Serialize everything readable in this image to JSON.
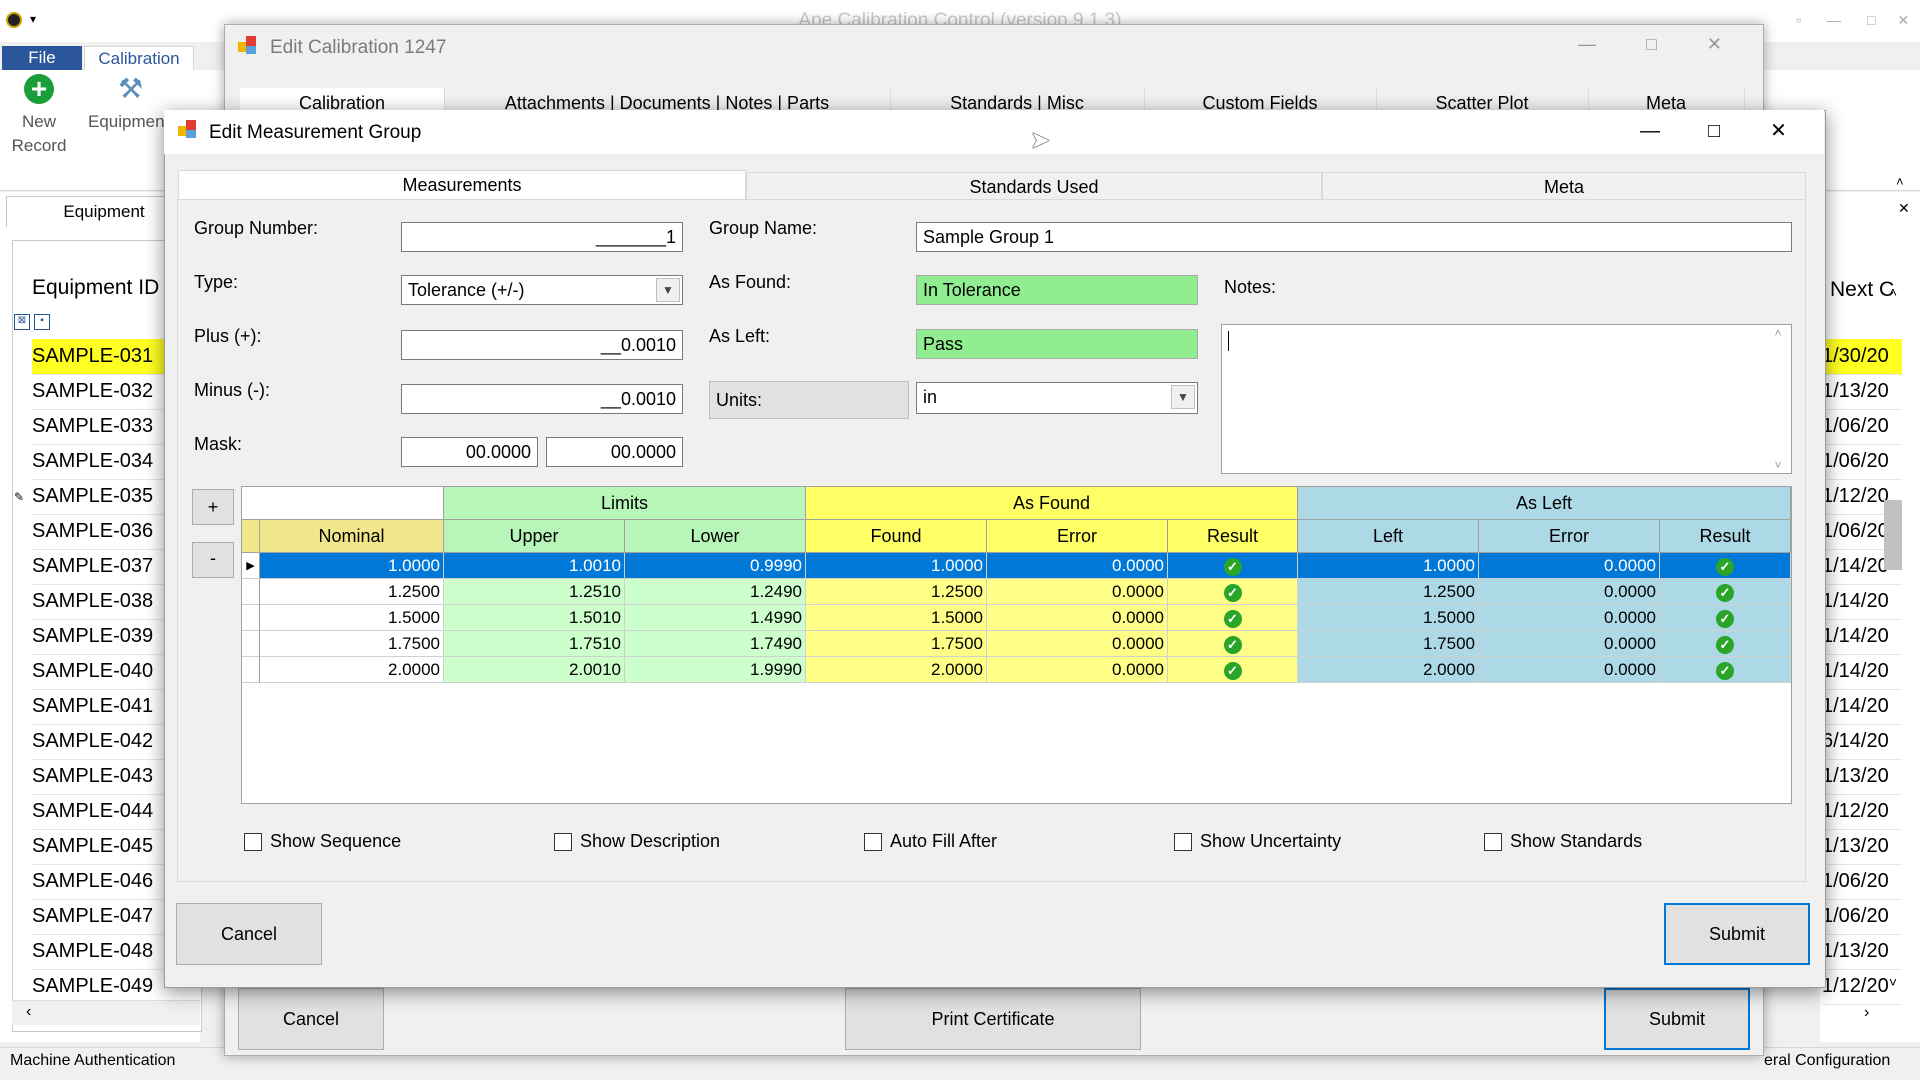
{
  "app": {
    "title": "Ape Calibration Control (version 9.1.3)",
    "ribbon_tabs": [
      "File",
      "Calibration"
    ],
    "new_record": "New Record",
    "equipment_btn": "Equipment",
    "equipment_tab": "Equipment",
    "equipment_id_header": "Equipment ID",
    "next_header": "Next C",
    "equipment_rows": [
      "SAMPLE-031",
      "SAMPLE-032",
      "SAMPLE-033",
      "SAMPLE-034",
      "SAMPLE-035",
      "SAMPLE-036",
      "SAMPLE-037",
      "SAMPLE-038",
      "SAMPLE-039",
      "SAMPLE-040",
      "SAMPLE-041",
      "SAMPLE-042",
      "SAMPLE-043",
      "SAMPLE-044",
      "SAMPLE-045",
      "SAMPLE-046",
      "SAMPLE-047",
      "SAMPLE-048",
      "SAMPLE-049"
    ],
    "next_rows": [
      "1/30/20",
      "1/13/20",
      "1/06/20",
      "1/06/20",
      "1/12/20",
      "1/06/20",
      "1/14/20",
      "1/14/20",
      "1/14/20",
      "1/14/20",
      "1/14/20",
      "6/14/20",
      "1/13/20",
      "1/12/20",
      "1/13/20",
      "1/06/20",
      "1/06/20",
      "1/13/20",
      "1/12/20"
    ],
    "status_left": "Machine Authentication",
    "status_right": "eral Configuration"
  },
  "calibration_window": {
    "title": "Edit Calibration 1247",
    "tabs": [
      "Calibration",
      "Attachments | Documents | Notes | Parts",
      "Standards | Misc",
      "Custom Fields",
      "Scatter Plot",
      "Meta"
    ],
    "cancel": "Cancel",
    "print_certificate": "Print Certificate",
    "submit": "Submit"
  },
  "measurement_group": {
    "title": "Edit Measurement Group",
    "tabs": [
      "Measurements",
      "Standards Used",
      "Meta"
    ],
    "group_number_label": "Group Number:",
    "group_number_value": "_______1",
    "group_name_label": "Group Name:",
    "group_name_value": "Sample Group 1",
    "type_label": "Type:",
    "type_value": "Tolerance (+/-)",
    "as_found_label": "As Found:",
    "as_found_value": "In Tolerance",
    "notes_label": "Notes:",
    "plus_label": "Plus (+):",
    "plus_value": "__0.0010",
    "as_left_label": "As Left:",
    "as_left_value": "Pass",
    "minus_label": "Minus (-):",
    "minus_value": "__0.0010",
    "units_label": "Units:",
    "units_value": "in",
    "mask_label": "Mask:",
    "mask_value_1": "00.0000",
    "mask_value_2": "00.0000",
    "add_row": "+",
    "remove_row": "-",
    "grid": {
      "group_headers": [
        "Limits",
        "As Found",
        "As Left"
      ],
      "columns": [
        "Nominal",
        "Upper",
        "Lower",
        "Found",
        "Error",
        "Result",
        "Left",
        "Error",
        "Result"
      ],
      "rows": [
        [
          "1.0000",
          "1.0010",
          "0.9990",
          "1.0000",
          "0.0000",
          "1.0000",
          "0.0000"
        ],
        [
          "1.2500",
          "1.2510",
          "1.2490",
          "1.2500",
          "0.0000",
          "1.2500",
          "0.0000"
        ],
        [
          "1.5000",
          "1.5010",
          "1.4990",
          "1.5000",
          "0.0000",
          "1.5000",
          "0.0000"
        ],
        [
          "1.7500",
          "1.7510",
          "1.7490",
          "1.7500",
          "0.0000",
          "1.7500",
          "0.0000"
        ],
        [
          "2.0000",
          "2.0010",
          "1.9990",
          "2.0000",
          "0.0000",
          "2.0000",
          "0.0000"
        ]
      ]
    },
    "options": [
      "Show Sequence",
      "Show Description",
      "Auto Fill After",
      "Show Uncertainty",
      "Show Standards"
    ],
    "cancel": "Cancel",
    "submit": "Submit"
  },
  "colors": {
    "limits": "#ccffcc",
    "limits_header": "#b8f5b8",
    "as_found": "#ffff88",
    "as_found_header": "#ffff66",
    "as_left": "#add8e6",
    "nominal_header": "#f0e68c",
    "selected": "#0078d7",
    "accent_green": "#90ee90"
  }
}
